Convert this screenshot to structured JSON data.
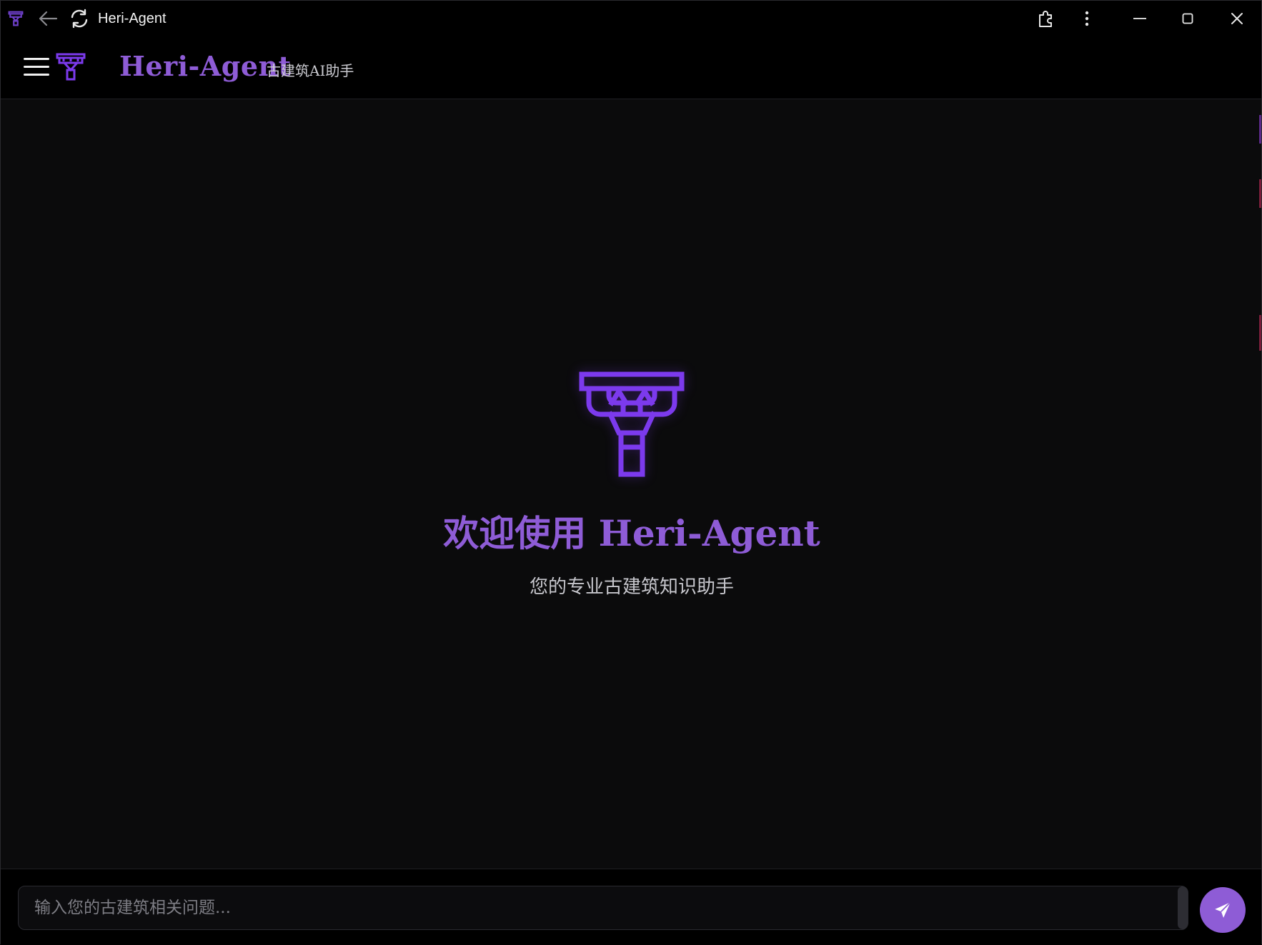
{
  "titlebar": {
    "title": "Heri-Agent",
    "icons": [
      "app-logo-icon",
      "back-arrow-icon",
      "refresh-icon",
      "extensions-icon",
      "more-vertical-icon",
      "minimize-icon",
      "maximize-icon",
      "close-icon"
    ]
  },
  "header": {
    "brand": "Heri-Agent",
    "subtitle": "古建筑AI助手",
    "icons": [
      "menu-icon",
      "temple-logo-icon"
    ]
  },
  "welcome": {
    "title": "欢迎使用 Heri-Agent",
    "subtitle": "您的专业古建筑知识助手",
    "icon": "temple-logo-icon"
  },
  "composer": {
    "placeholder": "输入您的古建筑相关问题...",
    "value": "",
    "send_icon": "paper-plane-icon"
  },
  "colors": {
    "accent": "#8e5cd6",
    "logo": "#7c3aed",
    "background": "#0b0b0c",
    "bar": "#000000"
  }
}
